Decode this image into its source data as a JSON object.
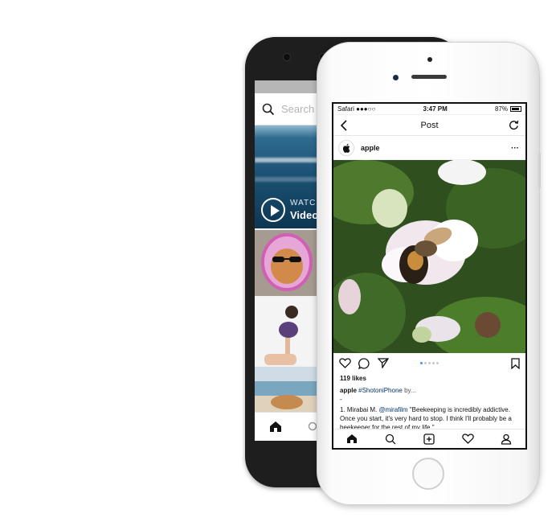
{
  "back_phone": {
    "search_placeholder": "Search",
    "watch_label": "WATCH",
    "video_label": "Video"
  },
  "front_phone": {
    "status": {
      "carrier": "Safari",
      "signal": "●●●○○",
      "time": "3:47 PM",
      "battery": "87%"
    },
    "header": {
      "title": "Post"
    },
    "post": {
      "username": "apple",
      "more": "···",
      "likes": "119 likes",
      "caption_user": "apple",
      "caption_tag": "#ShotoniPhone",
      "caption_more": " by...",
      "dash": "-",
      "quote_prefix": "1. Mirabai M. ",
      "quote_mention": "@mirafilm",
      "quote_text": " \"Beekeeping is incredibly addictive. Once you start, it's very hard to stop. I think I'll probably be a beekeeper for the rest of my life.\""
    },
    "carousel": {
      "count": 5,
      "active": 1
    }
  },
  "colors": {
    "link": "#003569",
    "dot_active": "#3897f0",
    "back_phone_body": "#1e1e1e"
  }
}
